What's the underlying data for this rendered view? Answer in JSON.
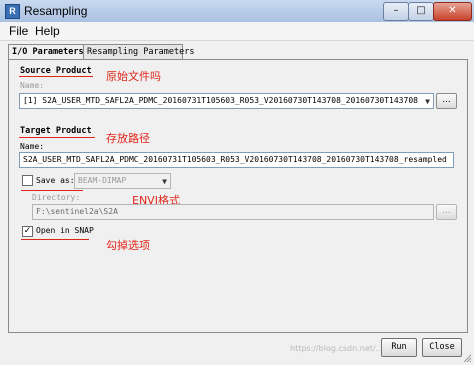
{
  "window": {
    "title": "Resampling",
    "app_icon_glyph": "R"
  },
  "menu": {
    "file": "File",
    "help": "Help"
  },
  "tabs": {
    "io": "I/O Parameters",
    "resampling": "Resampling Parameters"
  },
  "source": {
    "group_label": "Source Product",
    "name_label": "Name:",
    "selected_product": "[1] S2A_USER_MTD_SAFL2A_PDMC_20160731T105603_R053_V20160730T143708_20160730T143708",
    "note": "原始文件吗"
  },
  "target": {
    "group_label": "Target Product",
    "name_label": "Name:",
    "name_value": "S2A_USER_MTD_SAFL2A_PDMC_20160731T105603_R053_V20160730T143708_20160730T143708_resampled",
    "note": "存放路径",
    "save_as_label": "Save as:",
    "save_as_format": "BEAM-DIMAP",
    "format_note": "ENVI格式",
    "directory_label": "Directory:",
    "directory_value": "F:\\sentinel2a\\S2A",
    "open_in_snap_label": "Open in SNAP",
    "open_in_snap_checked": true,
    "open_note": "勾掉选项"
  },
  "buttons": {
    "browse": "...",
    "run": "Run",
    "close": "Close"
  },
  "watermark": "https://blog.csdn.net/..."
}
